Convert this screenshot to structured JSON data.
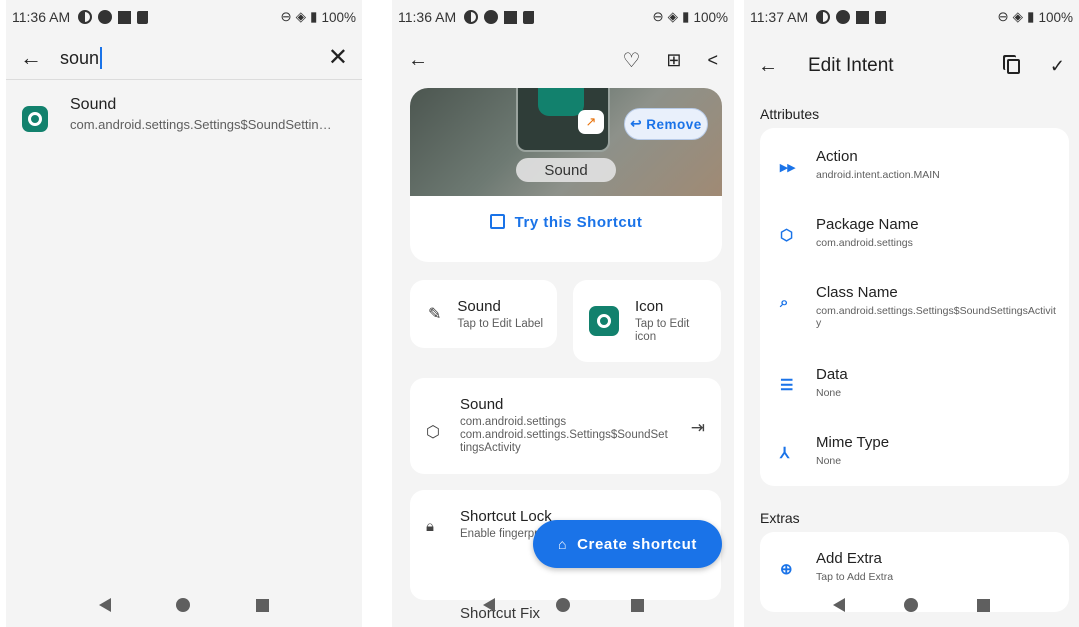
{
  "screen1": {
    "status": {
      "time": "11:36 AM",
      "battery": "100%"
    },
    "search": {
      "query": "soun"
    },
    "result": {
      "title": "Sound",
      "subtitle": "com.android.settings.Settings$SoundSettin…"
    }
  },
  "screen2": {
    "status": {
      "time": "11:36 AM",
      "battery": "100%"
    },
    "preview": {
      "label": "Sound",
      "remove_label": "Remove",
      "try_label": "Try this Shortcut"
    },
    "label_card": {
      "title": "Sound",
      "subtitle": "Tap to Edit Label"
    },
    "icon_card": {
      "title": "Icon",
      "subtitle": "Tap to Edit icon"
    },
    "intent_card": {
      "title": "Sound",
      "line1": "com.android.settings",
      "line2": "com.android.settings.Settings$SoundSettingsActivity"
    },
    "lock_card": {
      "title": "Shortcut Lock",
      "subtitle": "Enable fingerpri",
      "next_title": "Shortcut Fix"
    },
    "fab_label": "Create shortcut"
  },
  "screen3": {
    "status": {
      "time": "11:37 AM",
      "battery": "100%"
    },
    "title": "Edit Intent",
    "attributes_header": "Attributes",
    "attributes": [
      {
        "name": "Action",
        "value": "android.intent.action.MAIN"
      },
      {
        "name": "Package Name",
        "value": "com.android.settings"
      },
      {
        "name": "Class Name",
        "value": "com.android.settings.Settings$SoundSettingsActivity"
      },
      {
        "name": "Data",
        "value": "None"
      },
      {
        "name": "Mime Type",
        "value": "None"
      }
    ],
    "extras_header": "Extras",
    "add_extra": {
      "title": "Add Extra",
      "subtitle": "Tap to Add Extra"
    }
  }
}
